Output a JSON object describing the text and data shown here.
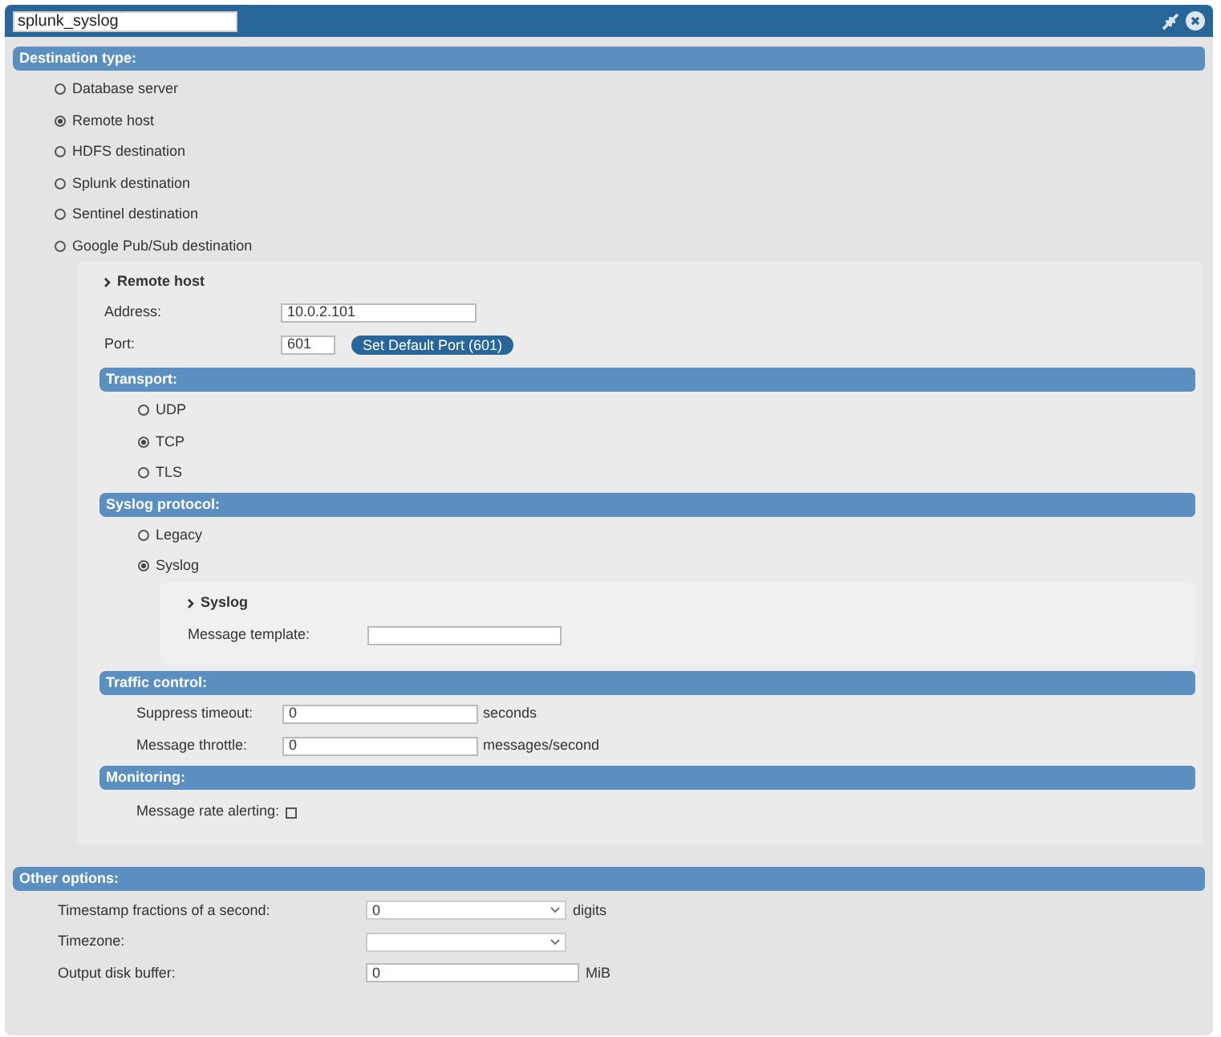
{
  "window": {
    "title": "splunk_syslog"
  },
  "destination_type": {
    "header": "Destination type:",
    "options": [
      {
        "label": "Database server",
        "selected": false
      },
      {
        "label": "Remote host",
        "selected": true
      },
      {
        "label": "HDFS destination",
        "selected": false
      },
      {
        "label": "Splunk destination",
        "selected": false
      },
      {
        "label": "Sentinel destination",
        "selected": false
      },
      {
        "label": "Google Pub/Sub destination",
        "selected": false
      }
    ]
  },
  "remote_host": {
    "heading": "Remote host",
    "address": {
      "label": "Address:",
      "value": "10.0.2.101"
    },
    "port": {
      "label": "Port:",
      "value": "601",
      "button": "Set Default Port (601)"
    },
    "transport": {
      "header": "Transport:",
      "options": [
        {
          "label": "UDP",
          "selected": false
        },
        {
          "label": "TCP",
          "selected": true
        },
        {
          "label": "TLS",
          "selected": false
        }
      ]
    },
    "syslog_protocol": {
      "header": "Syslog protocol:",
      "options": [
        {
          "label": "Legacy",
          "selected": false
        },
        {
          "label": "Syslog",
          "selected": true
        }
      ],
      "syslog": {
        "heading": "Syslog",
        "message_template": {
          "label": "Message template:"
        }
      }
    },
    "traffic_control": {
      "header": "Traffic control:",
      "fields": [
        {
          "label": "Suppress timeout:",
          "value": "0",
          "unit": "seconds"
        },
        {
          "label": "Message throttle:",
          "value": "0",
          "unit": "messages/second"
        }
      ]
    },
    "monitoring": {
      "header": "Monitoring:",
      "message_rate_alerting": {
        "label": "Message rate alerting:",
        "checked": false
      }
    }
  },
  "other_options": {
    "header": "Other options:",
    "fields": [
      {
        "kind": "select",
        "label": "Timestamp fractions of a second:",
        "value": "0",
        "unit": "digits"
      },
      {
        "kind": "select",
        "label": "Timezone:"
      },
      {
        "kind": "input",
        "label": "Output disk buffer:",
        "value": "0",
        "unit": "MiB"
      }
    ]
  }
}
